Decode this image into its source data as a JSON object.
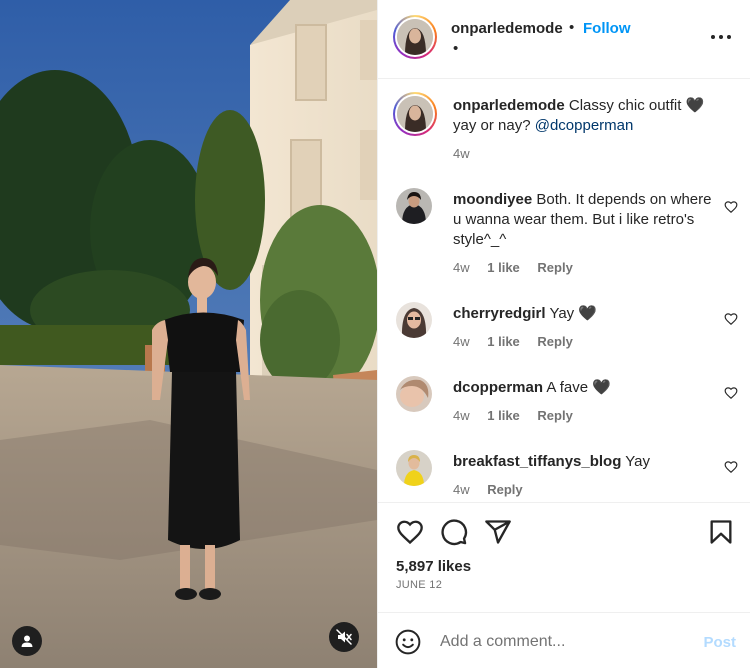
{
  "post": {
    "author": "onparledemode",
    "follow_label": "Follow",
    "header_separator": "•",
    "header_subtext": "•"
  },
  "caption": {
    "username": "onparledemode",
    "text": " Classy chic outfit 🖤 yay or nay? ",
    "mention": "@dcopperman",
    "age": "4w"
  },
  "comments": [
    {
      "username": "moondiyee",
      "text": " Both. It depends on where u wanna wear them. But i like retro's style^_^",
      "age": "4w",
      "likes": "1 like",
      "reply": "Reply"
    },
    {
      "username": "cherryredgirl",
      "text": " Yay 🖤",
      "age": "4w",
      "likes": "1 like",
      "reply": "Reply"
    },
    {
      "username": "dcopperman",
      "text": " A fave 🖤",
      "age": "4w",
      "likes": "1 like",
      "reply": "Reply"
    },
    {
      "username": "breakfast_tiffanys_blog",
      "text": " Yay",
      "age": "4w",
      "likes": "",
      "reply": "Reply"
    }
  ],
  "engagement": {
    "likes": "5,897 likes",
    "date": "JUNE 12"
  },
  "composer": {
    "placeholder": "Add a comment...",
    "post_label": "Post"
  },
  "icons": {
    "more": "more-options-icon",
    "like": "heart-icon",
    "comment": "comment-icon",
    "share": "send-icon",
    "save": "bookmark-icon",
    "emoji": "emoji-icon",
    "user_tag": "user-tag-icon",
    "mute": "muted-speaker-icon"
  },
  "colors": {
    "accent": "#0095f6",
    "mention": "#00376b",
    "muted_text": "#737373",
    "post_disabled": "#b3dbff"
  }
}
